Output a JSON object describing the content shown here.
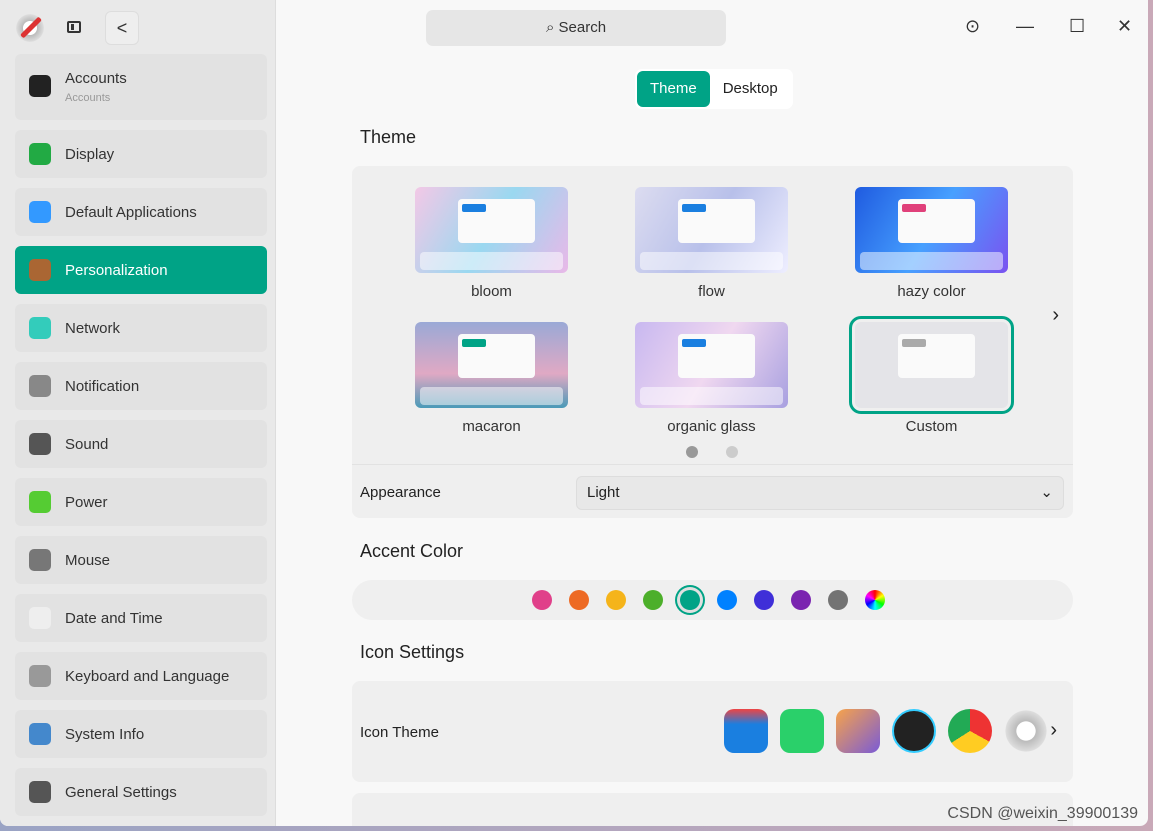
{
  "sidebar": {
    "items": [
      {
        "label": "Accounts",
        "sub": "Accounts",
        "icon": "user-icon"
      },
      {
        "label": "Display",
        "icon": "monitor-icon"
      },
      {
        "label": "Default Applications",
        "icon": "apps-icon"
      },
      {
        "label": "Personalization",
        "icon": "palette-icon",
        "selected": true
      },
      {
        "label": "Network",
        "icon": "network-icon"
      },
      {
        "label": "Notification",
        "icon": "bell-icon"
      },
      {
        "label": "Sound",
        "icon": "speaker-icon"
      },
      {
        "label": "Power",
        "icon": "battery-icon"
      },
      {
        "label": "Mouse",
        "icon": "mouse-icon"
      },
      {
        "label": "Date and Time",
        "icon": "clock-icon"
      },
      {
        "label": "Keyboard and Language",
        "icon": "keyboard-icon"
      },
      {
        "label": "System Info",
        "icon": "info-icon"
      },
      {
        "label": "General Settings",
        "icon": "gear-icon"
      }
    ]
  },
  "header": {
    "search": "Search",
    "back": "<"
  },
  "tabs": [
    "Theme",
    "Desktop"
  ],
  "theme": {
    "title": "Theme",
    "cards": [
      "bloom",
      "flow",
      "hazy color",
      "macaron",
      "organic glass",
      "Custom"
    ],
    "selected": "Custom",
    "page": 1,
    "pages": 2,
    "appearance_label": "Appearance",
    "appearance_value": "Light"
  },
  "accent": {
    "title": "Accent Color",
    "colors": [
      "#e0408a",
      "#ed6a24",
      "#f5b41a",
      "#4caf2a",
      "#00a386",
      "#0081ff",
      "#3f2fd8",
      "#7a24b0",
      "#737373",
      "multicolor"
    ],
    "selected": "#00a386"
  },
  "icons": {
    "title": "Icon Settings",
    "theme_label": "Icon Theme"
  },
  "watermark": "CSDN @weixin_39900139"
}
